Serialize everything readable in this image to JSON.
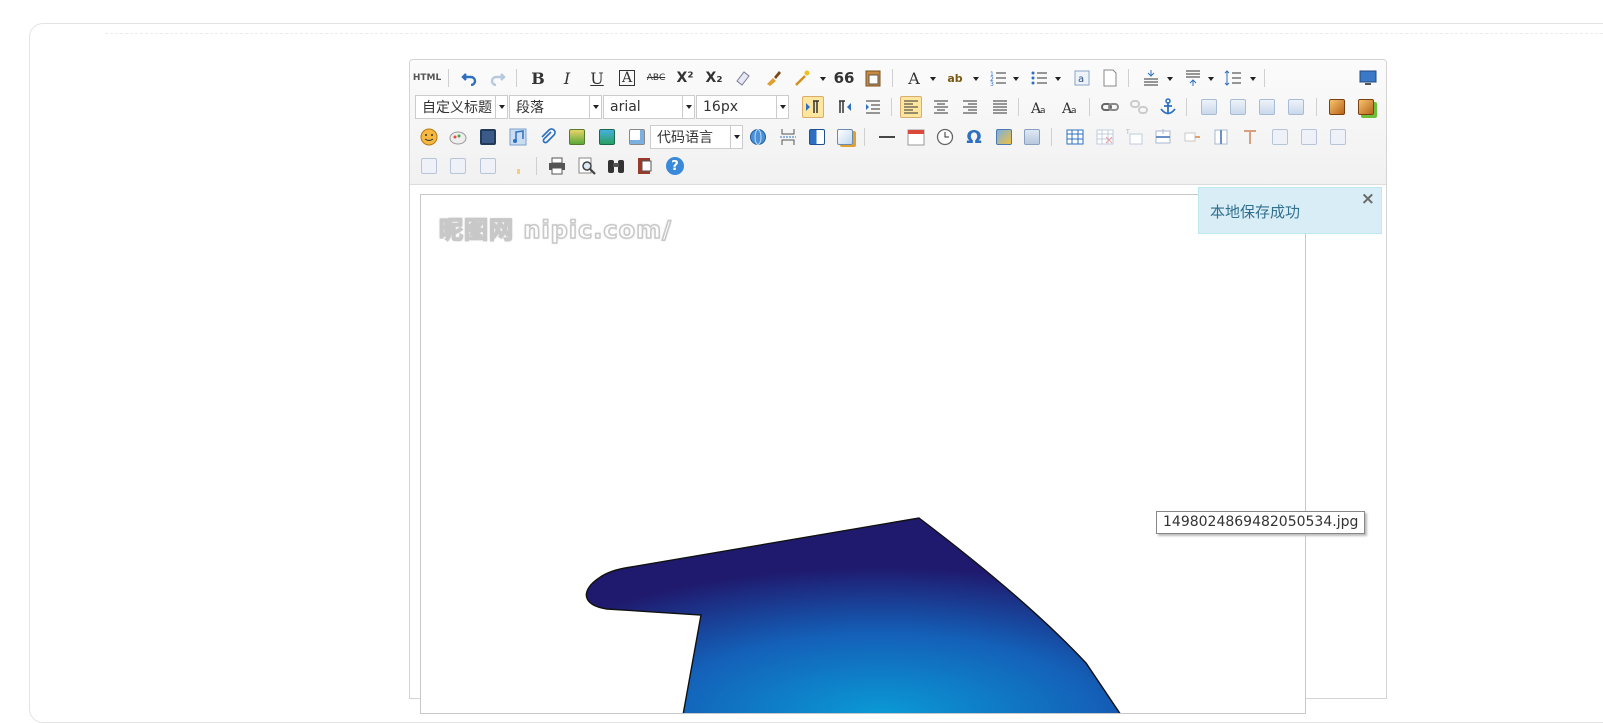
{
  "toolbar": {
    "source_label": "HTML",
    "bold_label": "B",
    "italic_label": "I",
    "underline_label": "U",
    "fontborder_label": "A",
    "strike_label": "ABC",
    "superscript_label": "X²",
    "subscript_label": "X₂",
    "blockquote_label": "66",
    "forecolor_label": "A",
    "backcolor_label": "ab",
    "omega_label": "Ω",
    "help_label": "?",
    "custom_style": "自定义标题",
    "paragraph": "段落",
    "font_family": "arial",
    "font_size": "16px",
    "code_language": "代码语言"
  },
  "editor": {
    "watermark": "昵图网 nipic.com/"
  },
  "notification": {
    "message": "本地保存成功",
    "close_label": "×"
  },
  "image_tooltip": {
    "filename": "1498024869482050534.jpg"
  },
  "colors": {
    "notice_bg": "#d9edf7",
    "notice_text": "#31708f",
    "active_button_bg": "#ffe69f",
    "cap_center": "#0a9ad6",
    "cap_edge": "#1f1a6e"
  }
}
